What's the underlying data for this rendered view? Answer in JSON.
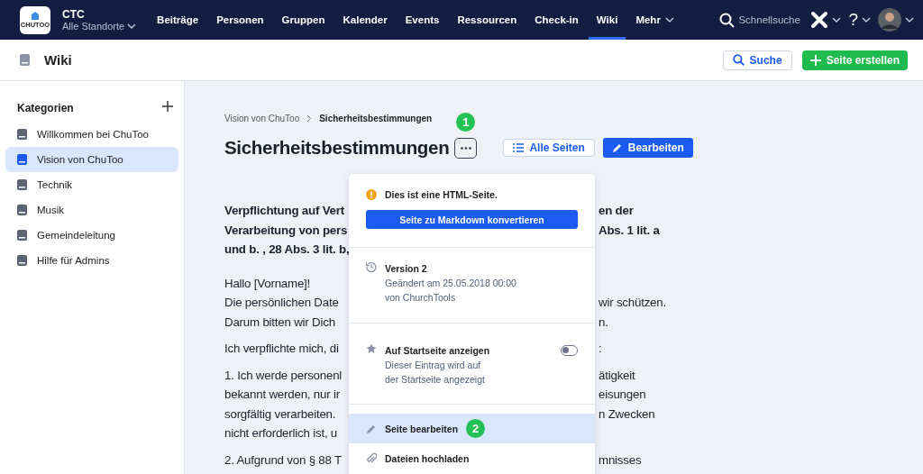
{
  "topbar": {
    "logo_text": "CHUTOO",
    "org": "CTC",
    "location": "Alle Standorte",
    "nav": [
      {
        "label": "Beiträge",
        "selected": false
      },
      {
        "label": "Personen",
        "selected": false
      },
      {
        "label": "Gruppen",
        "selected": false
      },
      {
        "label": "Kalender",
        "selected": false
      },
      {
        "label": "Events",
        "selected": false
      },
      {
        "label": "Ressourcen",
        "selected": false
      },
      {
        "label": "Check-in",
        "selected": false
      },
      {
        "label": "Wiki",
        "selected": true
      },
      {
        "label": "Mehr",
        "selected": false,
        "dropdown": true
      }
    ],
    "search_placeholder": "Schnellsuche",
    "help": "?"
  },
  "header": {
    "title": "Wiki",
    "search_button": "Suche",
    "create_button": "Seite erstellen"
  },
  "sidebar": {
    "title": "Kategorien",
    "items": [
      {
        "label": "Willkommen bei ChuToo",
        "selected": false
      },
      {
        "label": "Vision von ChuToo",
        "selected": true
      },
      {
        "label": "Technik",
        "selected": false
      },
      {
        "label": "Musik",
        "selected": false
      },
      {
        "label": "Gemeindeleitung",
        "selected": false
      },
      {
        "label": "Hilfe für Admins",
        "selected": false
      }
    ]
  },
  "page": {
    "breadcrumb": [
      "Vision von ChuToo",
      "Sicherheitsbestimmungen"
    ],
    "title": "Sicherheitsbestimmungen",
    "title_badge": "1",
    "all_pages_button": "Alle Seiten",
    "edit_button": "Bearbeiten",
    "paragraphs": [
      {
        "bold": true,
        "lines": [
          {
            "left": "Verpflichtung auf Vert",
            "right": "en der"
          },
          {
            "left": "Verarbeitung von pers",
            "right": "Abs. 1 lit. a"
          },
          {
            "left": "und b. , 28 Abs. 3 lit. b,"
          }
        ]
      },
      {
        "bold": false,
        "lines": [
          {
            "left": "Hallo [Vorname]!"
          },
          {
            "left": "Die persönlichen Date",
            "right": "wir schützen."
          },
          {
            "left": "Darum bitten wir Dich",
            "right": "n."
          }
        ]
      },
      {
        "bold": false,
        "lines": [
          {
            "left": "Ich verpflichte mich, di",
            "right": ":"
          }
        ]
      },
      {
        "bold": false,
        "lines": [
          {
            "left": "1. Ich werde personenl",
            "right": "ätigkeit"
          },
          {
            "left": "bekannt werden, nur ir",
            "right": "eisungen"
          },
          {
            "left": "sorgfältig verarbeiten.",
            "right": "n Zwecken"
          },
          {
            "left": "nicht erforderlich ist, u"
          }
        ]
      },
      {
        "bold": false,
        "lines": [
          {
            "left": "2. Aufgrund von § 88 T",
            "right": "mnisses"
          }
        ]
      }
    ]
  },
  "popup": {
    "notice": "Dies ist eine HTML-Seite.",
    "convert_button": "Seite zu Markdown konvertieren",
    "version": {
      "title": "Version 2",
      "lines": [
        "Geändert am 25.05.2018 00:00",
        "von ChurchTools"
      ]
    },
    "feature": {
      "title": "Auf Startseite anzeigen",
      "lines": [
        "Dieser Eintrag wird auf",
        "der Startseite angezeigt"
      ],
      "on": false
    },
    "items": [
      {
        "kind": "edit",
        "label": "Seite bearbeiten",
        "selected": true,
        "badge": "2"
      },
      {
        "kind": "upload",
        "label": "Dateien hochladen",
        "selected": false
      }
    ]
  }
}
